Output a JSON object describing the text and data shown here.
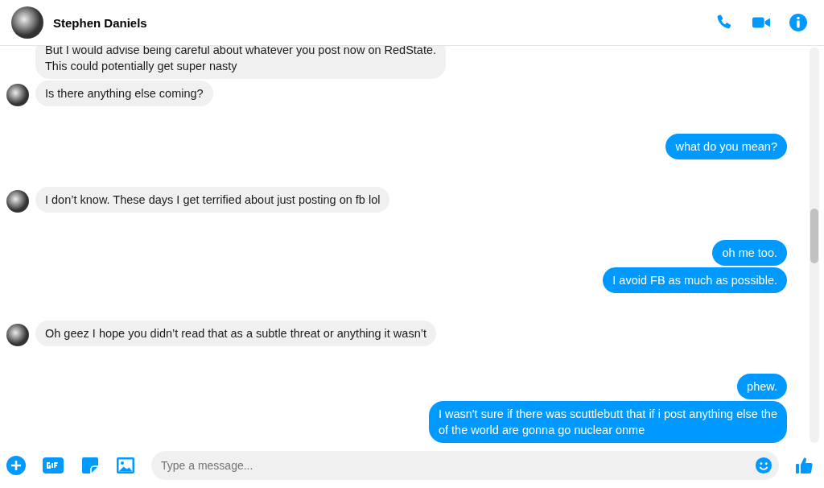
{
  "contact": {
    "name": "Stephen Daniels"
  },
  "groups": [
    {
      "kind": "incoming",
      "messages": [
        "But I would advise being careful about whatever you post now on RedState.\nThis could potentially get super nasty",
        "Is there anything else coming?"
      ]
    },
    {
      "kind": "outgoing",
      "messages": [
        "what do you mean?"
      ]
    },
    {
      "kind": "incoming",
      "messages": [
        "I don’t know. These days I get terrified about just posting on fb lol"
      ]
    },
    {
      "kind": "outgoing",
      "messages": [
        "oh me too.",
        "I avoid FB as much as possible."
      ]
    },
    {
      "kind": "incoming",
      "messages": [
        "Oh geez I hope you didn’t read that as a subtle threat or anything it wasn’t"
      ]
    },
    {
      "kind": "outgoing",
      "messages": [
        "phew.",
        "I wasn't sure if there was scuttlebutt that if i post anything else the\nof the world are gonna go nuclear onme"
      ]
    }
  ],
  "composer": {
    "placeholder": "Type a message..."
  }
}
